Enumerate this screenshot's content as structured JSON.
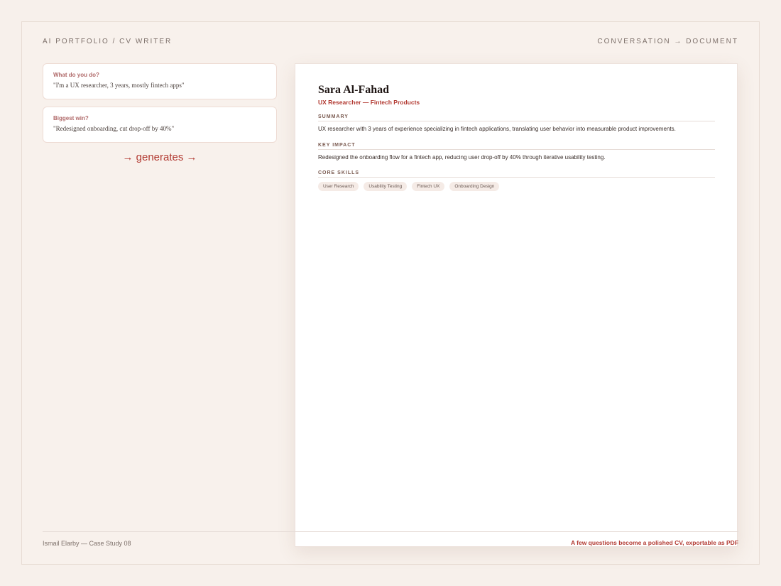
{
  "header": {
    "left": "AI PORTFOLIO / CV WRITER",
    "right": "CONVERSATION → DOCUMENT"
  },
  "conversation": [
    {
      "question": "What do you do?",
      "answer": "\"I'm a UX researcher, 3 years, mostly fintech apps\""
    },
    {
      "question": "Biggest win?",
      "answer": "\"Redesigned onboarding, cut drop-off by 40%\""
    }
  ],
  "generates_label": "→ generates →",
  "cv": {
    "name": "Sara Al-Fahad",
    "role": "UX Researcher — Fintech Products",
    "summary_heading": "SUMMARY",
    "summary": "UX researcher with 3 years of experience specializing in fintech applications, translating user behavior into measurable product improvements.",
    "impact_heading": "KEY IMPACT",
    "impact": "Redesigned the onboarding flow for a fintech app, reducing user drop-off by 40% through iterative usability testing.",
    "skills_heading": "CORE SKILLS",
    "skills": [
      "User Research",
      "Usability Testing",
      "Fintech UX",
      "Onboarding Design"
    ]
  },
  "footer": {
    "left": "Ismail Elarby — Case Study 08",
    "right": "A few questions become a polished CV, exportable as PDF"
  },
  "colors": {
    "background": "#f7f0eb",
    "accent": "#b23a32",
    "question": "#b06a6a"
  }
}
